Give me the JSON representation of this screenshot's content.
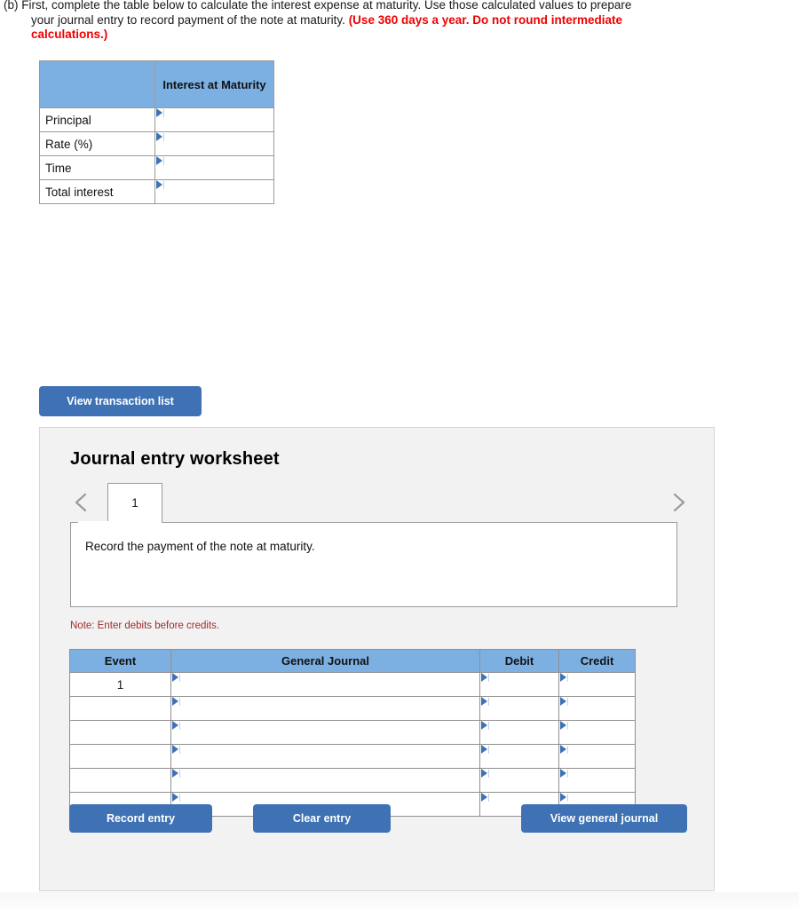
{
  "prompt": {
    "line1": "(b) First, complete the table below to calculate the interest expense at maturity. Use those calculated values to prepare your journal entry to record payment of the note at maturity. ",
    "emphasis": "(Use 360 days a year. Do not round intermediate calculations.)"
  },
  "interest_table": {
    "blank_header": "",
    "value_header": "Interest at Maturity",
    "rows": [
      {
        "label": "Principal",
        "value": ""
      },
      {
        "label": "Rate (%)",
        "value": ""
      },
      {
        "label": "Time",
        "value": ""
      },
      {
        "label": "Total interest",
        "value": ""
      }
    ]
  },
  "buttons": {
    "view_transaction_list": "View transaction list",
    "record_entry": "Record entry",
    "clear_entry": "Clear entry",
    "view_general_journal": "View general journal"
  },
  "worksheet": {
    "title": "Journal entry worksheet",
    "prev_icon": "chevron-left-icon",
    "next_icon": "chevron-right-icon",
    "tabs": [
      {
        "label": "1",
        "active": true
      }
    ],
    "description": "Record the payment of the note at maturity.",
    "note": "Note: Enter debits before credits.",
    "journal": {
      "headers": [
        "Event",
        "General Journal",
        "Debit",
        "Credit"
      ],
      "rows": [
        {
          "event": "1",
          "general_journal": "",
          "debit": "",
          "credit": ""
        },
        {
          "event": "",
          "general_journal": "",
          "debit": "",
          "credit": ""
        },
        {
          "event": "",
          "general_journal": "",
          "debit": "",
          "credit": ""
        },
        {
          "event": "",
          "general_journal": "",
          "debit": "",
          "credit": ""
        },
        {
          "event": "",
          "general_journal": "",
          "debit": "",
          "credit": ""
        },
        {
          "event": "",
          "general_journal": "",
          "debit": "",
          "credit": ""
        }
      ]
    }
  },
  "colors": {
    "table_header_blue": "#7db0e2",
    "button_blue": "#3f72b5",
    "emphasis_red": "#ee0000",
    "note_red": "#a02c2c",
    "panel_gray": "#f2f2f2"
  }
}
